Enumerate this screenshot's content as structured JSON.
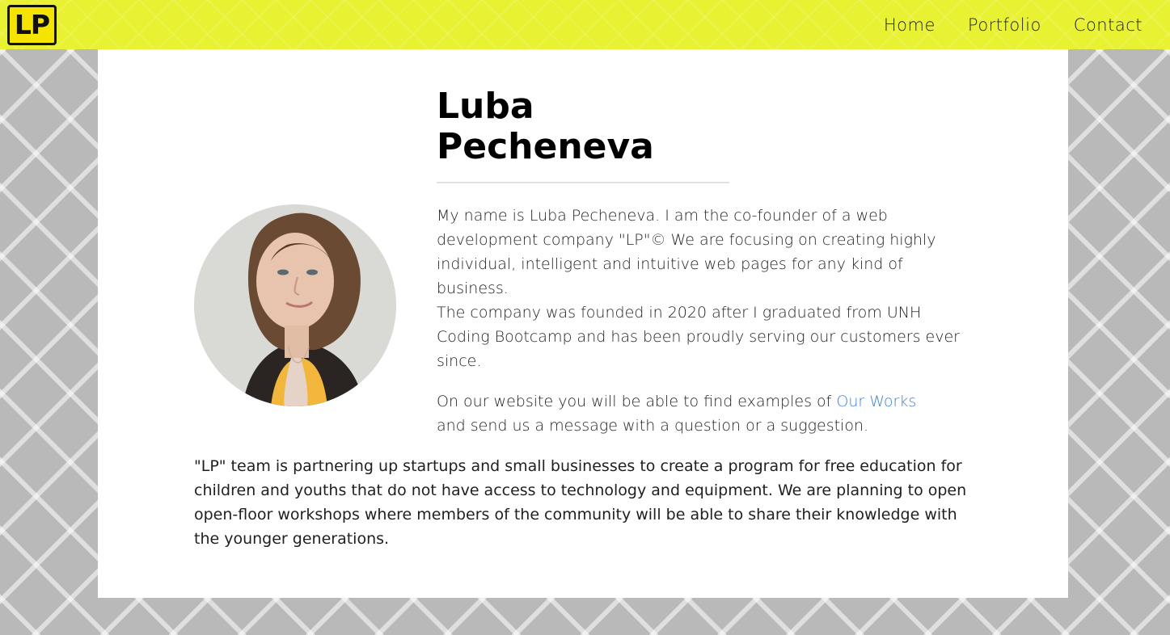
{
  "nav": {
    "logo_text": "LP",
    "links": [
      "Home",
      "Portfolio",
      "Contact"
    ]
  },
  "profile": {
    "name_line1": "Luba",
    "name_line2": "Pecheneva",
    "paragraph1": "My name is Luba Pecheneva. I am the co-founder of a web development company \"LP\"© We are focusing on creating highly individual, intelligent and intuitive web pages for any kind of business.",
    "paragraph2": "The company was founded in 2020 after I graduated from UNH Coding Bootcamp and has been proudly serving our customers ever since.",
    "paragraph3_before": "On our website you will be able to find examples of ",
    "paragraph3_link": "Our Works",
    "paragraph3_after": "and send us a message with a question or a suggestion.",
    "paragraph4": "\"LP\" team is partnering up startups and small businesses to create a program for free education for children and youths that do not have access to technology and equipment. We are planning to open open-floor workshops where members of the community will be able to share their knowledge with the younger generations."
  },
  "colors": {
    "nav_background": "#e8f233",
    "link": "#3b82d8",
    "page_background": "#b9b9b9"
  },
  "icons": {
    "logo": "lp-logo"
  }
}
